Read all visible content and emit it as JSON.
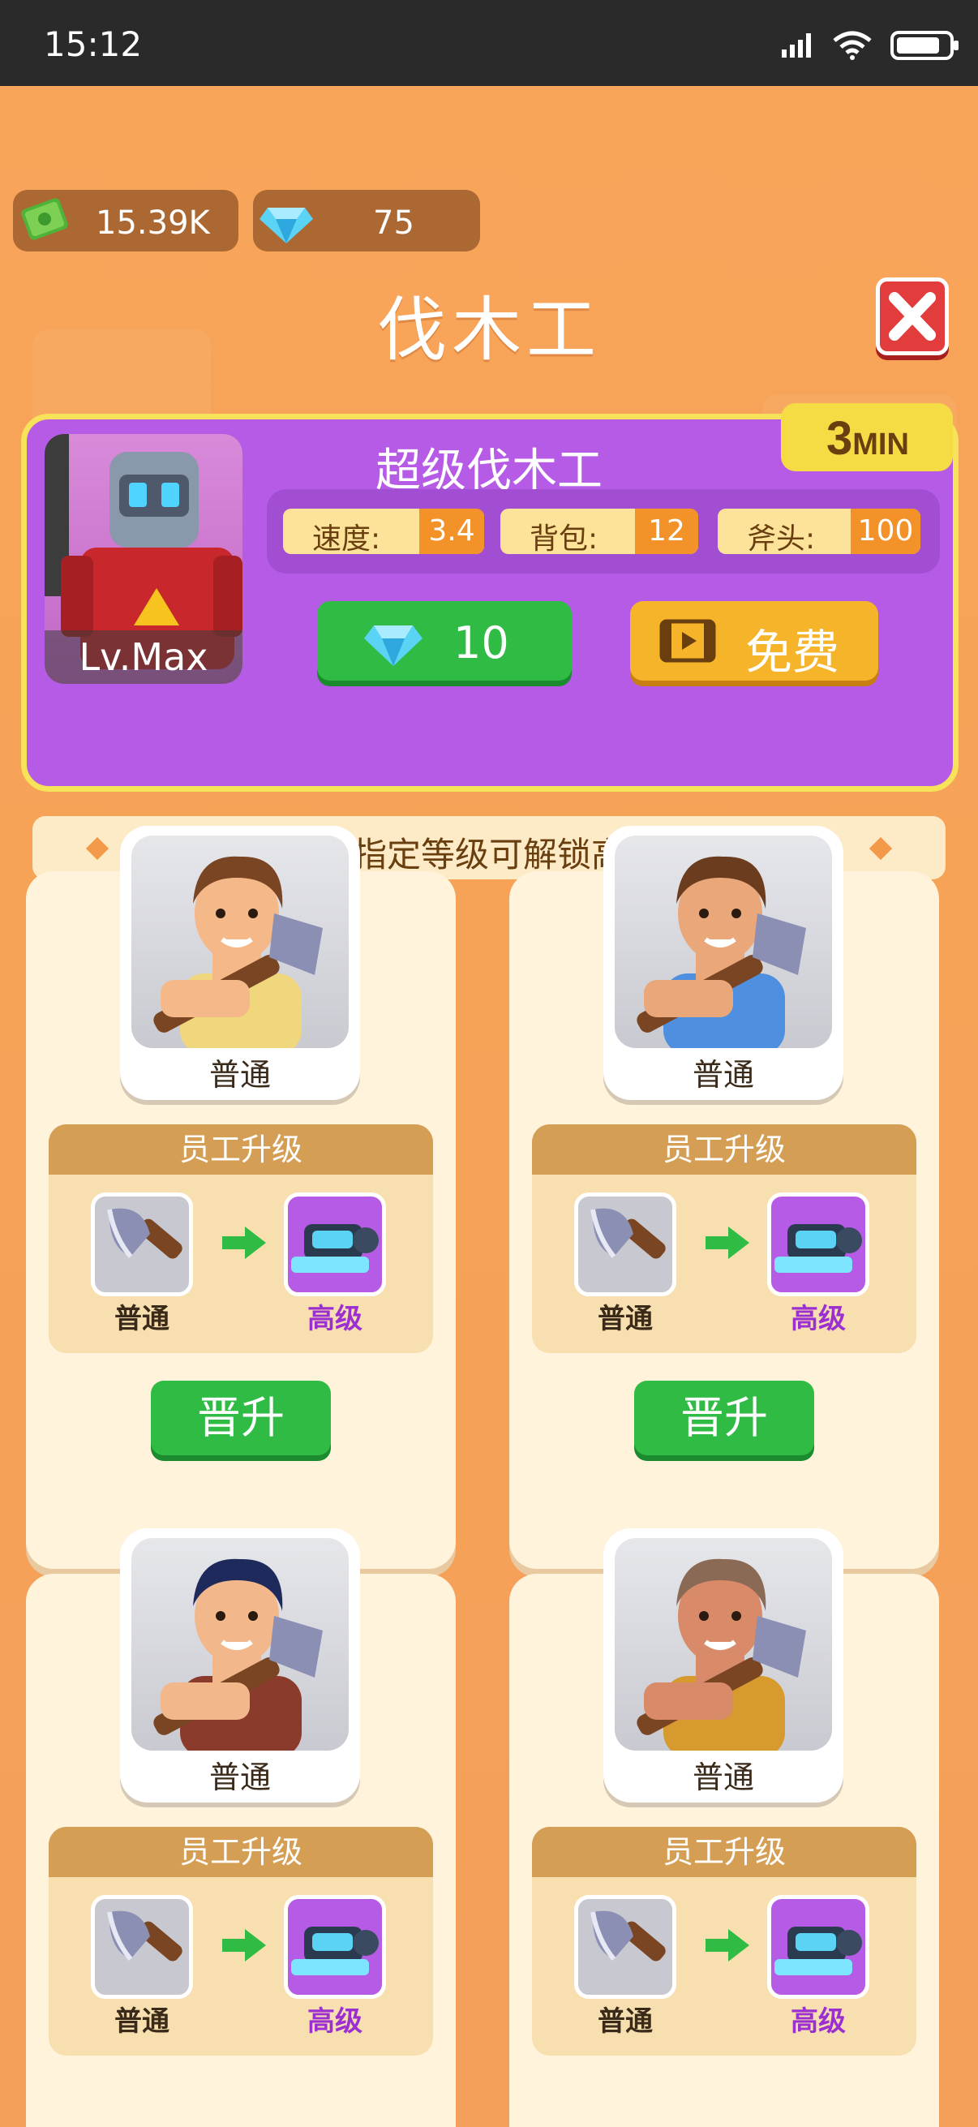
{
  "status_bar": {
    "time": "15:12"
  },
  "currency": {
    "cash": "15.39K",
    "gems": "75"
  },
  "title": "伐木工",
  "hero": {
    "name": "超级伐木工",
    "level": "Lv.Max",
    "badge_number": "3",
    "badge_unit": "MIN",
    "stats": [
      {
        "label": "速度:",
        "value": "3.4"
      },
      {
        "label": "背包:",
        "value": "12"
      },
      {
        "label": "斧头:",
        "value": "100"
      }
    ],
    "gem_cost": "10",
    "free_label": "免费"
  },
  "hint": "升级到指定等级可解锁高级外观",
  "employees": [
    {
      "grade": "普通",
      "upgrade_title": "员工升级",
      "from_label": "普通",
      "to_label": "高级",
      "button": "晋升",
      "shirt": "#f0d67c",
      "hair": "#7a4522",
      "skin": "#f4b889"
    },
    {
      "grade": "普通",
      "upgrade_title": "员工升级",
      "from_label": "普通",
      "to_label": "高级",
      "button": "晋升",
      "shirt": "#4f8fe0",
      "hair": "#6b3d1e",
      "skin": "#e9a77a"
    },
    {
      "grade": "普通",
      "upgrade_title": "员工升级",
      "from_label": "普通",
      "to_label": "高级",
      "shirt": "#8a3b2c",
      "hair": "#1f2a5c",
      "skin": "#f2b88c"
    },
    {
      "grade": "普通",
      "upgrade_title": "员工升级",
      "from_label": "普通",
      "to_label": "高级",
      "shirt": "#d79a2e",
      "hair": "#8a6a55",
      "skin": "#d98a68"
    }
  ],
  "colors": {
    "background": "#f7a356",
    "hero_card": "#b65be6",
    "green_button": "#2fbb44",
    "label_normal": "#3a2a1a",
    "label_advanced": "#9b2fd0"
  }
}
